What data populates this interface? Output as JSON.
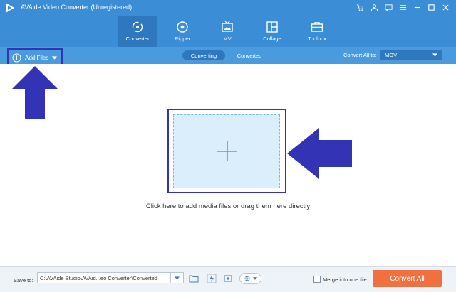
{
  "window": {
    "title": "AVAide Video Converter (Unregistered)",
    "icons": [
      "cart-icon",
      "user-icon",
      "feedback-icon",
      "menu-icon",
      "minimize-icon",
      "maximize-icon",
      "close-icon"
    ]
  },
  "nav": {
    "tabs": [
      {
        "label": "Converter",
        "icon": "converter-icon",
        "active": true
      },
      {
        "label": "Ripper",
        "icon": "ripper-icon",
        "active": false
      },
      {
        "label": "MV",
        "icon": "mv-icon",
        "active": false
      },
      {
        "label": "Collage",
        "icon": "collage-icon",
        "active": false
      },
      {
        "label": "Toolbox",
        "icon": "toolbox-icon",
        "active": false
      }
    ]
  },
  "toolbar": {
    "add_files_label": "Add Files",
    "segments": [
      "Converting",
      "Converted"
    ],
    "active_segment": "Converting",
    "convert_all_to_label": "Convert All to:",
    "format_value": "MOV"
  },
  "main": {
    "drop_hint": "Click here to add media files or drag them here directly"
  },
  "bottom": {
    "save_to_label": "Save to:",
    "save_path": "C:\\AVAide Studio\\AVAid...eo Converter\\Converted",
    "merge_label": "Merge into one file",
    "merge_checked": false,
    "convert_all_button": "Convert All"
  },
  "colors": {
    "topbar": "#3b8ed6",
    "active_tab": "#2f78bf",
    "annotation": "#3333b5",
    "convert_button": "#f07040",
    "drop_zone": "#daeefb"
  }
}
